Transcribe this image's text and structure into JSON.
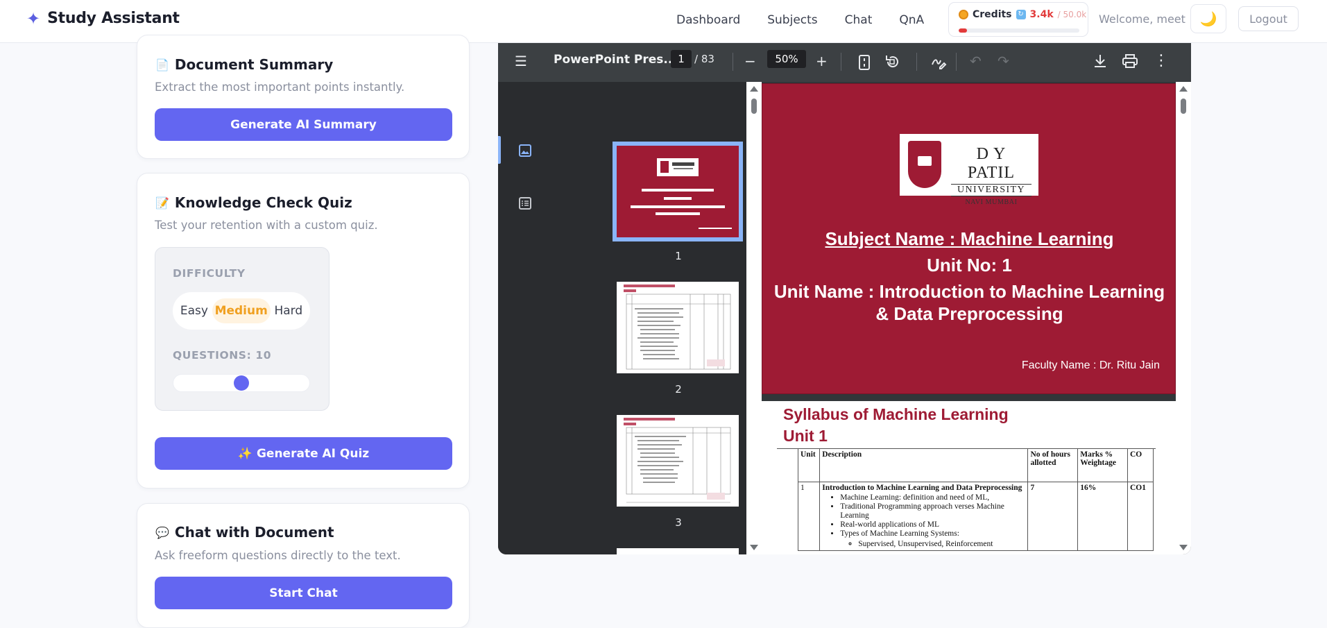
{
  "app": {
    "brand_icon": "sparkle-icon",
    "brand_name": "Study Assistant"
  },
  "nav": [
    "Dashboard",
    "Subjects",
    "Chat",
    "QnA"
  ],
  "credits": {
    "label": "Credits",
    "used": "3.4k",
    "total": "/ 50.0k",
    "fraction_used": 0.068,
    "accent": "#e23b3b"
  },
  "user": {
    "welcome": "Welcome, meet",
    "theme_icon": "moon-icon",
    "logout": "Logout"
  },
  "cards": {
    "summary": {
      "icon": "document-icon",
      "title": "Document Summary",
      "desc": "Extract the most important points instantly.",
      "button": "Generate AI Summary"
    },
    "quiz": {
      "icon": "memo-icon",
      "title": "Knowledge Check Quiz",
      "desc": "Test your retention with a custom quiz.",
      "difficulty_label": "DIFFICULTY",
      "difficulty_options": [
        "Easy",
        "Medium",
        "Hard"
      ],
      "difficulty_selected": "Medium",
      "questions_label": "QUESTIONS: 10",
      "questions_value": 10,
      "questions_fraction": 0.5,
      "button_icon": "✨",
      "button": "Generate AI Quiz"
    },
    "chat": {
      "icon": "speech-bubble-icon",
      "title": "Chat with Document",
      "desc": "Ask freeform questions directly to the text.",
      "button": "Start Chat"
    }
  },
  "viewer": {
    "title": "PowerPoint Pres...",
    "page_current": "1",
    "page_total": "/ 83",
    "zoom": "50%",
    "thumbnails": [
      "1",
      "2",
      "3"
    ],
    "page1": {
      "logo_line1": "D Y PATIL",
      "logo_line2": "UNIVERSITY",
      "logo_line3": "NAVI MUMBAI",
      "subject": "Subject Name : Machine Learning",
      "unit_no": "Unit No: 1",
      "unit_name_1": "Unit Name : Introduction to Machine Learning",
      "unit_name_2": "& Data Preprocessing",
      "faculty": "Faculty Name : Dr. Ritu Jain"
    },
    "page2": {
      "title_1": "Syllabus of Machine Learning",
      "title_2": "Unit 1",
      "headers": [
        "Unit",
        "Description",
        "No of hours allotted",
        "Marks % Weightage",
        "CO"
      ],
      "row": {
        "unit": "1",
        "heading": "Introduction to Machine Learning and Data Preprocessing",
        "bullets": [
          "Machine Learning:  definition and need of ML,",
          "Traditional Programming approach verses Machine Learning",
          "Real-world applications of ML",
          "Types of Machine Learning Systems:"
        ],
        "sub_bullet": "Supervised, Unsupervised, Reinforcement",
        "hours": "7",
        "marks": "16%",
        "co": "CO1"
      }
    }
  }
}
